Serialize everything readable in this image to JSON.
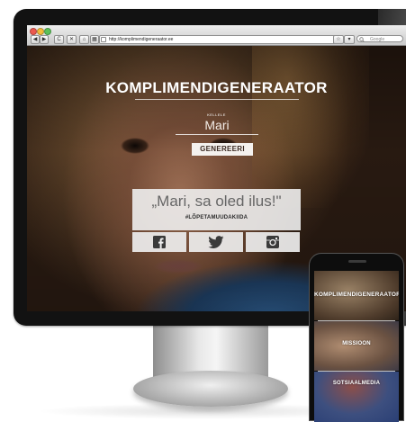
{
  "browser": {
    "url": "http://komplimendigeneraator.ee",
    "search_placeholder": "Google",
    "nav_back": "◀",
    "nav_forward": "▶",
    "nav_reload": "C",
    "nav_stop": "✕",
    "nav_home": "⌂"
  },
  "site": {
    "title": "KOMPLIMENDIGENERAATOR",
    "name_label": "KELLELE",
    "name_value": "Mari",
    "generate_label": "GENEREERI",
    "compliment": "„Mari, sa oled ilus!\"",
    "hashtag": "#LÕPETAMUUDAKIIDA",
    "share": {
      "facebook_icon": "facebook-icon",
      "twitter_icon": "twitter-icon",
      "instagram_icon": "instagram-icon"
    }
  },
  "phone": {
    "items": [
      {
        "label": "KOMPLIMENDIGENERAATOR"
      },
      {
        "label": "MISSIOON"
      },
      {
        "label": "SOTSIAALMEDIA"
      }
    ]
  },
  "colors": {
    "button_bg": "#f4f1ee",
    "button_text": "#3b2a22",
    "panel_bg": "#eeeeee",
    "traffic_red": "#ec5a50",
    "traffic_yellow": "#f5bd3a",
    "traffic_green": "#5cc15a"
  }
}
